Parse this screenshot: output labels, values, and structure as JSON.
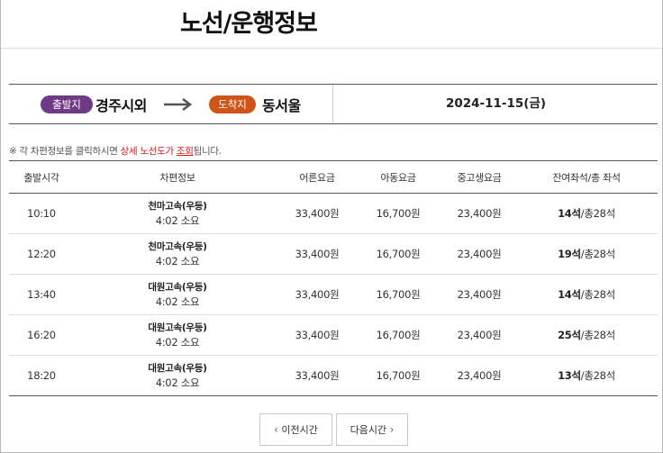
{
  "page_title": "노선/운행정보",
  "route": {
    "departure_badge": "출발지",
    "departure": "경주시외",
    "arrival_badge": "도착지",
    "arrival": "동서울",
    "date": "2024-11-15(금)",
    "colors": {
      "departure_badge": "#6f3a86",
      "arrival_badge": "#cf5417"
    }
  },
  "notice": {
    "prefix": "※ 각 차편정보를 클릭하시면 ",
    "highlight": "상세 노선도가",
    "highlight_underline": "조회",
    "suffix": "됩니다."
  },
  "table": {
    "headers": [
      "출발시각",
      "차편정보",
      "어른요금",
      "아동요금",
      "중고생요금",
      "잔여좌석/총 좌석"
    ],
    "rows": [
      {
        "time": "10:10",
        "operator": "천마고속(우등)",
        "duration": "4:02 소요",
        "adult": "33,400원",
        "child": "16,700원",
        "student": "23,400원",
        "seats_left": "14석",
        "seats_total": "/총28석"
      },
      {
        "time": "12:20",
        "operator": "천마고속(우등)",
        "duration": "4:02 소요",
        "adult": "33,400원",
        "child": "16,700원",
        "student": "23,400원",
        "seats_left": "19석",
        "seats_total": "/총28석"
      },
      {
        "time": "13:40",
        "operator": "대원고속(우등)",
        "duration": "4:02 소요",
        "adult": "33,400원",
        "child": "16,700원",
        "student": "23,400원",
        "seats_left": "14석",
        "seats_total": "/총28석"
      },
      {
        "time": "16:20",
        "operator": "대원고속(우등)",
        "duration": "4:02 소요",
        "adult": "33,400원",
        "child": "16,700원",
        "student": "23,400원",
        "seats_left": "25석",
        "seats_total": "/총28석"
      },
      {
        "time": "18:20",
        "operator": "대원고속(우등)",
        "duration": "4:02 소요",
        "adult": "33,400원",
        "child": "16,700원",
        "student": "23,400원",
        "seats_left": "13석",
        "seats_total": "/총28석"
      }
    ]
  },
  "pagination": {
    "prev_label": "이전시간",
    "next_label": "다음시간"
  }
}
